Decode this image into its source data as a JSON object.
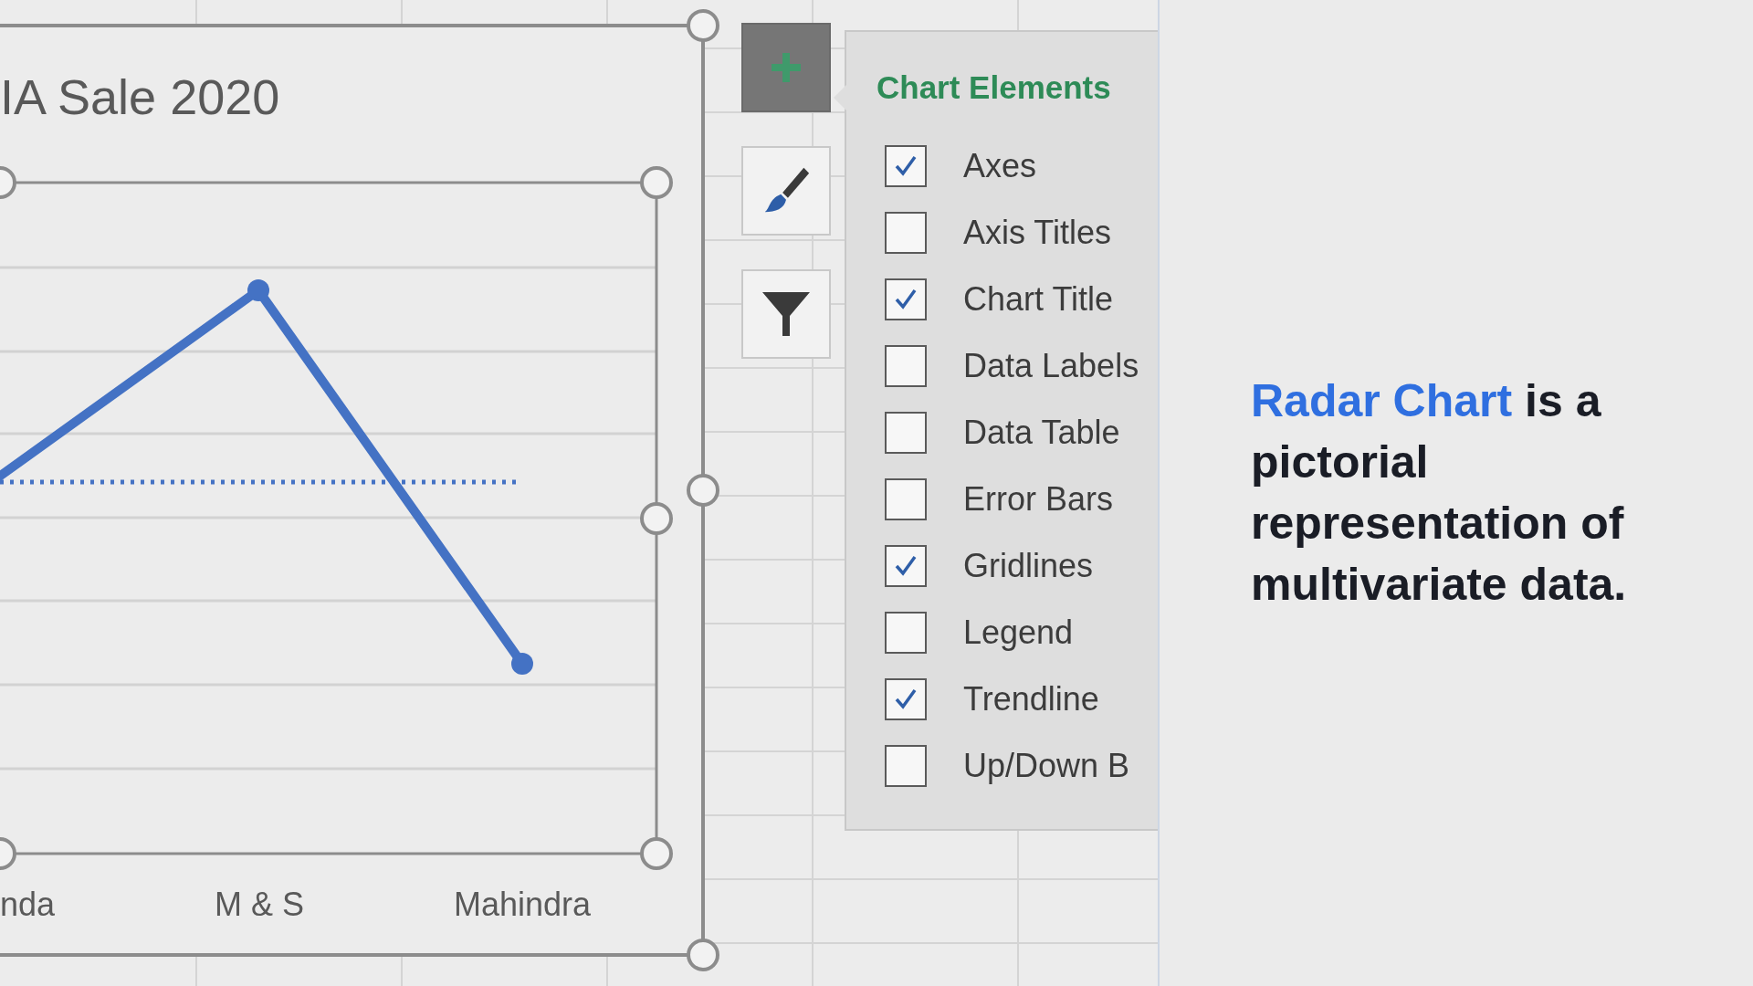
{
  "chart": {
    "title": "IA Sale 2020",
    "categories": [
      "nda",
      "M & S",
      "Mahindra"
    ]
  },
  "chart_buttons": [
    {
      "kind": "add"
    },
    {
      "kind": "style"
    },
    {
      "kind": "filter"
    }
  ],
  "chart_elements": {
    "title": "Chart Elements",
    "items": [
      {
        "label": "Axes",
        "checked": true
      },
      {
        "label": "Axis Titles",
        "checked": false
      },
      {
        "label": "Chart Title",
        "checked": true
      },
      {
        "label": "Data Labels",
        "checked": false
      },
      {
        "label": "Data Table",
        "checked": false
      },
      {
        "label": "Error Bars",
        "checked": false
      },
      {
        "label": "Gridlines",
        "checked": true
      },
      {
        "label": "Legend",
        "checked": false
      },
      {
        "label": "Trendline",
        "checked": true
      },
      {
        "label": "Up/Down B",
        "checked": false
      }
    ]
  },
  "caption": {
    "highlight": "Radar Chart",
    "text": "is a pictorial representation of multivariate data."
  }
}
